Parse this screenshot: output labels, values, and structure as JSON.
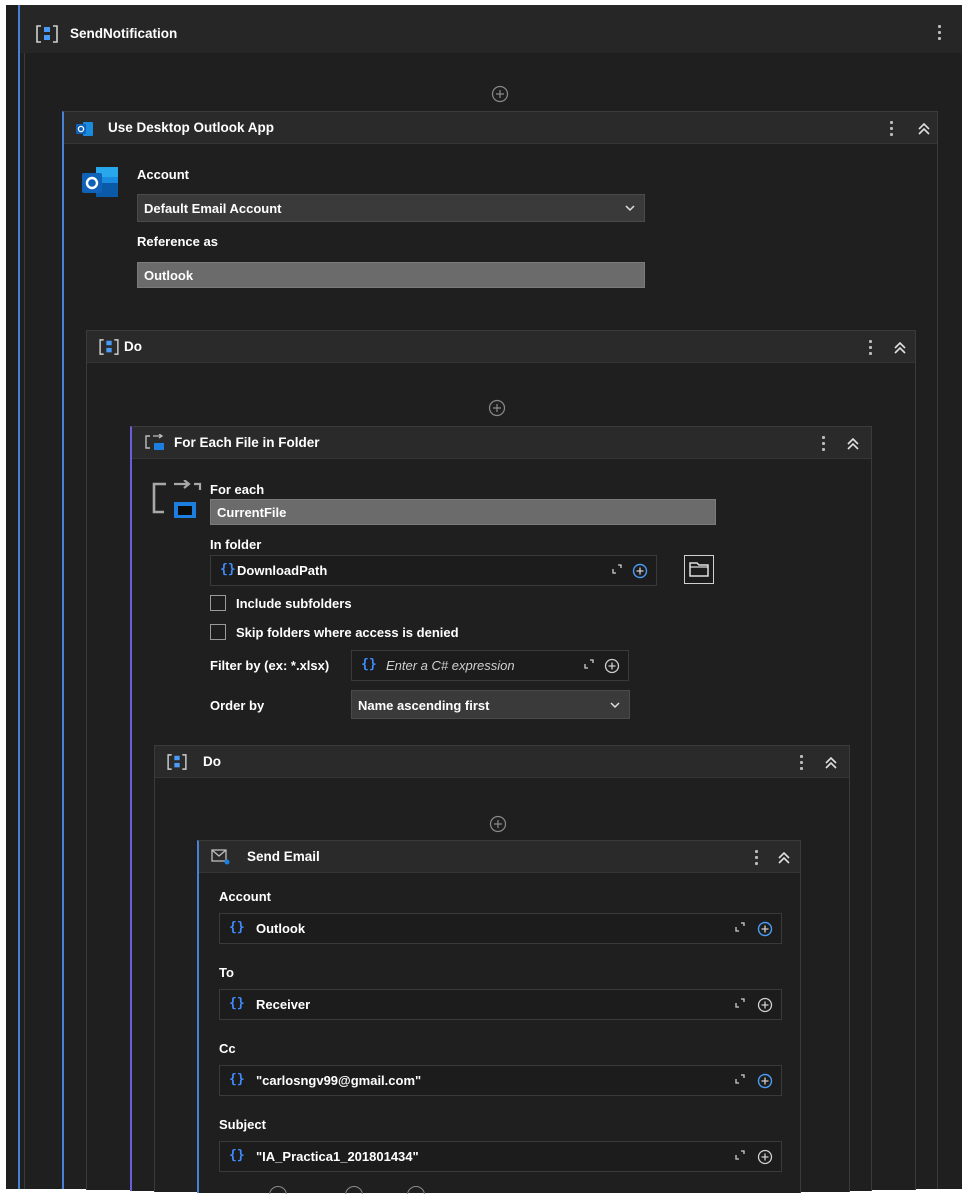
{
  "root": {
    "title": "SendNotification"
  },
  "outlook": {
    "title": "Use Desktop Outlook App",
    "account_label": "Account",
    "account_value": "Default Email Account",
    "reference_label": "Reference as",
    "reference_value": "Outlook"
  },
  "do_outer": {
    "title": "Do"
  },
  "foreach": {
    "title": "For Each File in Folder",
    "for_each_label": "For each",
    "for_each_value": "CurrentFile",
    "in_folder_label": "In folder",
    "in_folder_value": "DownloadPath",
    "include_subfolders_label": "Include subfolders",
    "skip_folders_label": "Skip folders where access is denied",
    "filter_label": "Filter by (ex: *.xlsx)",
    "filter_placeholder": "Enter a C# expression",
    "order_label": "Order by",
    "order_value": "Name ascending first"
  },
  "do_inner": {
    "title": "Do"
  },
  "send_email": {
    "title": "Send Email",
    "fields": [
      {
        "label": "Account",
        "value": "Outlook"
      },
      {
        "label": "To",
        "value": "Receiver"
      },
      {
        "label": "Cc",
        "value": "\"carlosngv99@gmail.com\""
      },
      {
        "label": "Subject",
        "value": "\"IA_Practica1_201801434\""
      }
    ]
  }
}
